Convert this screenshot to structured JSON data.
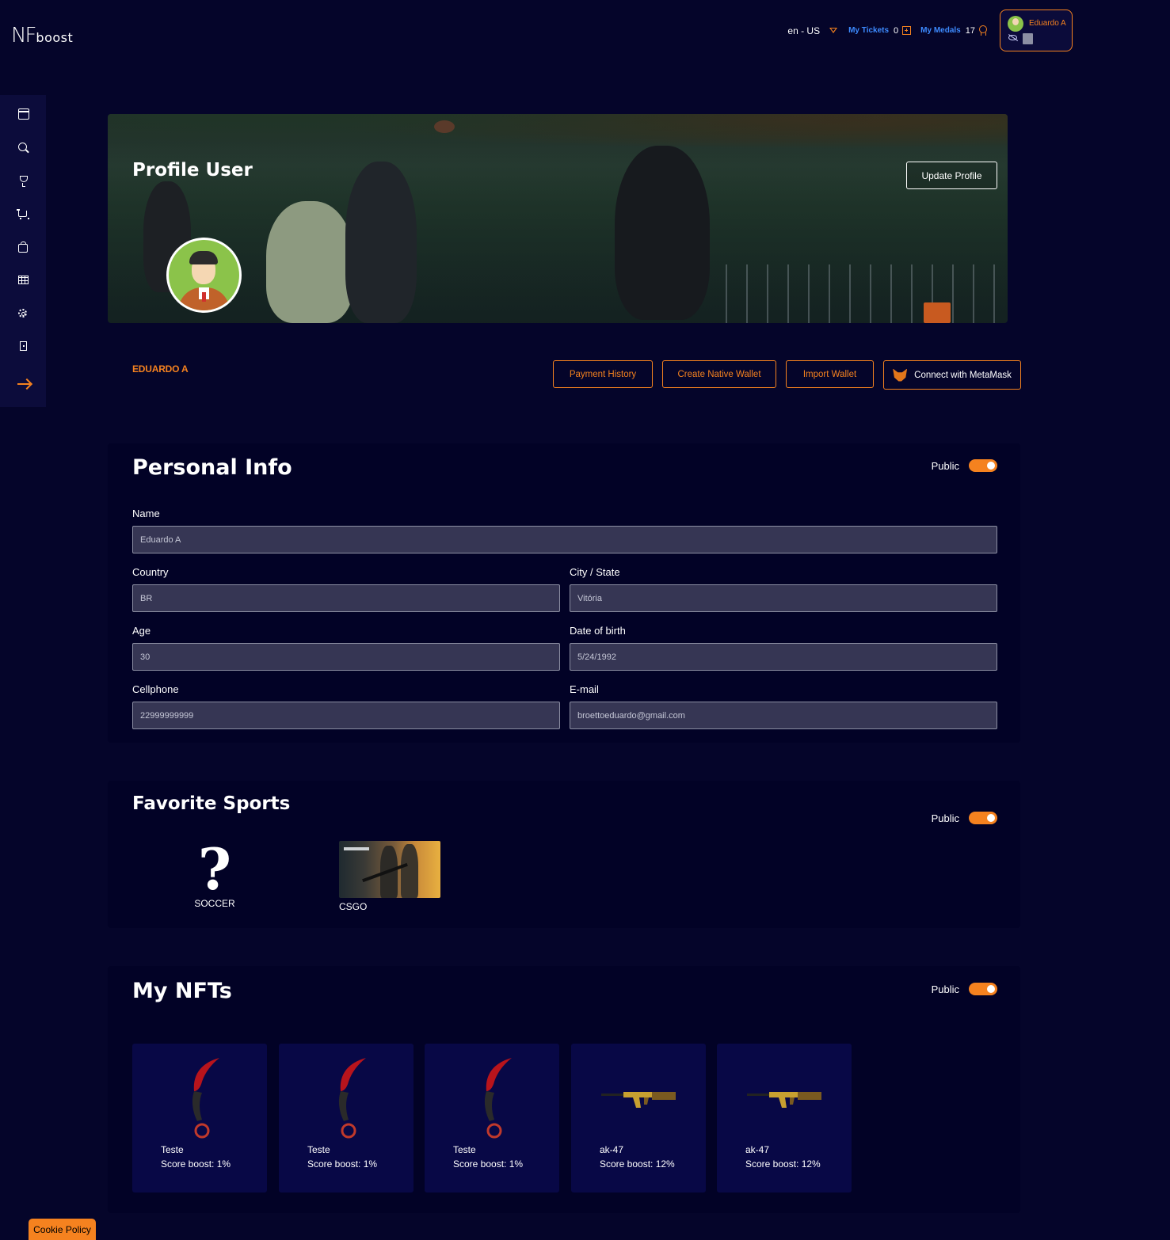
{
  "header": {
    "logo_nf": "NF",
    "logo_boost": "boost",
    "language": "en - US",
    "tickets_label": "My Tickets",
    "tickets_count": "0",
    "medals_label": "My Medals",
    "medals_count": "17",
    "user_name": "Eduardo A"
  },
  "sidebar": {
    "items": [
      {
        "icon": "calendar-icon"
      },
      {
        "icon": "search-icon"
      },
      {
        "icon": "trophy-icon"
      },
      {
        "icon": "cart-icon"
      },
      {
        "icon": "bag-icon"
      },
      {
        "icon": "table-icon"
      },
      {
        "icon": "gear-icon"
      },
      {
        "icon": "door-icon"
      },
      {
        "icon": "arrow-right-icon"
      }
    ]
  },
  "banner": {
    "title": "Profile User",
    "update_label": "Update Profile"
  },
  "profile": {
    "display_name": "EDUARDO A",
    "actions": {
      "payment_history": "Payment History",
      "create_wallet": "Create Native Wallet",
      "import_wallet": "Import Wallet",
      "metamask": "Connect with MetaMask"
    }
  },
  "personal_info": {
    "title": "Personal Info",
    "public_label": "Public",
    "fields": {
      "name": {
        "label": "Name",
        "value": "Eduardo A"
      },
      "country": {
        "label": "Country",
        "value": "BR"
      },
      "city": {
        "label": "City / State",
        "value": "Vitória"
      },
      "age": {
        "label": "Age",
        "value": "30"
      },
      "dob": {
        "label": "Date of birth",
        "value": "5/24/1992"
      },
      "cellphone": {
        "label": "Cellphone",
        "value": "22999999999"
      },
      "email": {
        "label": "E-mail",
        "value": "broettoeduardo@gmail.com"
      }
    }
  },
  "favorite_sports": {
    "title": "Favorite Sports",
    "public_label": "Public",
    "items": [
      {
        "label": "SOCCER",
        "placeholder_symbol": "?"
      },
      {
        "label": "CSGO"
      }
    ]
  },
  "nfts": {
    "title": "My NFTs",
    "public_label": "Public",
    "items": [
      {
        "name": "Teste",
        "boost": "Score boost: 1%",
        "kind": "knife"
      },
      {
        "name": "Teste",
        "boost": "Score boost: 1%",
        "kind": "knife"
      },
      {
        "name": "Teste",
        "boost": "Score boost: 1%",
        "kind": "knife"
      },
      {
        "name": "ak-47",
        "boost": "Score boost: 12%",
        "kind": "rifle"
      },
      {
        "name": "ak-47",
        "boost": "Score boost: 12%",
        "kind": "rifle"
      }
    ]
  },
  "cookie": {
    "label": "Cookie Policy"
  },
  "colors": {
    "accent": "#f5821f",
    "link": "#3d8bff",
    "background": "#05052a"
  }
}
